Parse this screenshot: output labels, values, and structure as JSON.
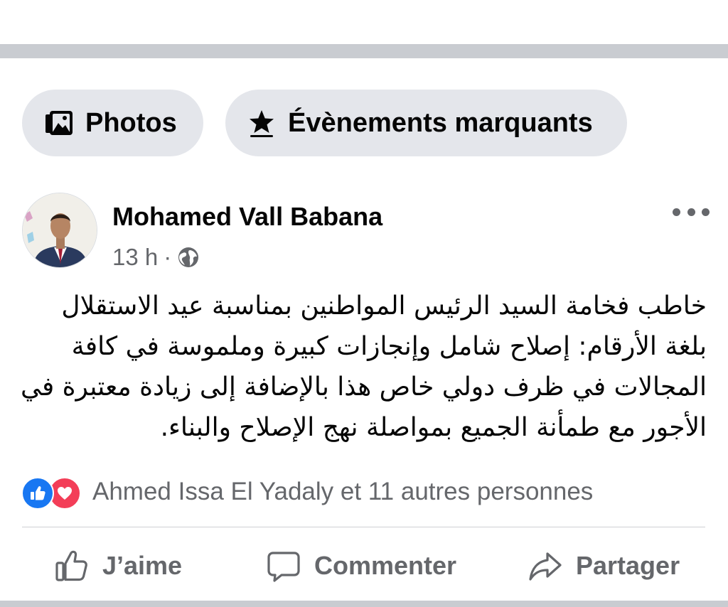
{
  "filters": {
    "photos": {
      "label": "Photos",
      "icon": "photos-icon"
    },
    "highlights": {
      "label": "Évènements marquants",
      "icon": "star-icon"
    }
  },
  "post": {
    "author": "Mohamed Vall Babana",
    "time": "13 h",
    "separator": "·",
    "audience_icon": "globe-icon",
    "more_icon": "more-options-icon",
    "text": "خاطب فخامة السيد الرئيس المواطنين بمناسبة عيد الاستقلال بلغة الأرقام: إصلاح شامل وإنجازات كبيرة وملموسة في كافة المجالات في ظرف دولي خاص هذا بالإضافة إلى زيادة معتبرة في الأجور مع طمأنة الجميع بمواصلة نهج الإصلاح والبناء."
  },
  "reactions": {
    "icons": [
      "like-reaction-icon",
      "love-reaction-icon"
    ],
    "summary": "Ahmed Issa El Yadaly et 11 autres personnes"
  },
  "actions": {
    "like": "J’aime",
    "comment": "Commenter",
    "share": "Partager"
  },
  "colors": {
    "chip_bg": "#e4e6eb",
    "secondary_text": "#65676b",
    "like_blue": "#1877f2",
    "love_red": "#f33e58",
    "separator_gray": "#c9ccd1"
  }
}
